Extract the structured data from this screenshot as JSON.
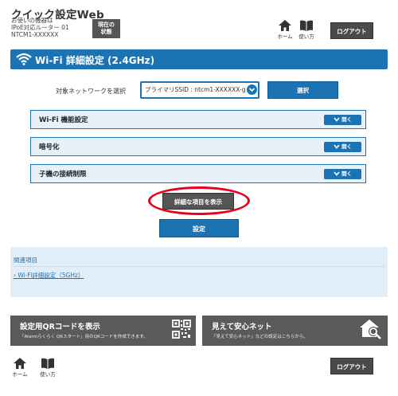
{
  "header": {
    "app_title": "クイック設定Web",
    "device_lines": [
      "お使いの機器は",
      "IPoE対応ルーター 01",
      "NTCM1-XXXXXX"
    ],
    "status_button": [
      "現在の",
      "状態"
    ],
    "home_label": "ホーム",
    "guide_label": "使い方",
    "logout_label": "ログアウト"
  },
  "section": {
    "title": "Wi-Fi 詳細設定 (2.4GHz)"
  },
  "network_select": {
    "label": "対象ネットワークを選択",
    "selected": "プライマリSSID : ntcm1-XXXXXX-g",
    "button": "選択"
  },
  "accordions": [
    {
      "label": "Wi-Fi 機能設定",
      "action": "開く"
    },
    {
      "label": "暗号化",
      "action": "開く"
    },
    {
      "label": "子機の接続制限",
      "action": "開く"
    }
  ],
  "show_detail_button": "詳細な項目を表示",
  "set_button": "設定",
  "related": {
    "title": "関連項目",
    "link": "Wi-Fi詳細設定（5GHz）"
  },
  "panels": {
    "qr": {
      "title": "設定用QRコードを表示",
      "desc": "「Atermらくらく QRスタート」用のQRコードを作成できます。"
    },
    "safe": {
      "title": "見えて安心ネット",
      "desc": "「見えて安心ネット」などの設定はこちらから。"
    }
  },
  "footer": {
    "home_label": "ホーム",
    "guide_label": "使い方",
    "logout_label": "ログアウト"
  },
  "colors": {
    "accent": "#1b73b3",
    "highlight_ring": "#e8001c",
    "dark_button": "#555555"
  }
}
